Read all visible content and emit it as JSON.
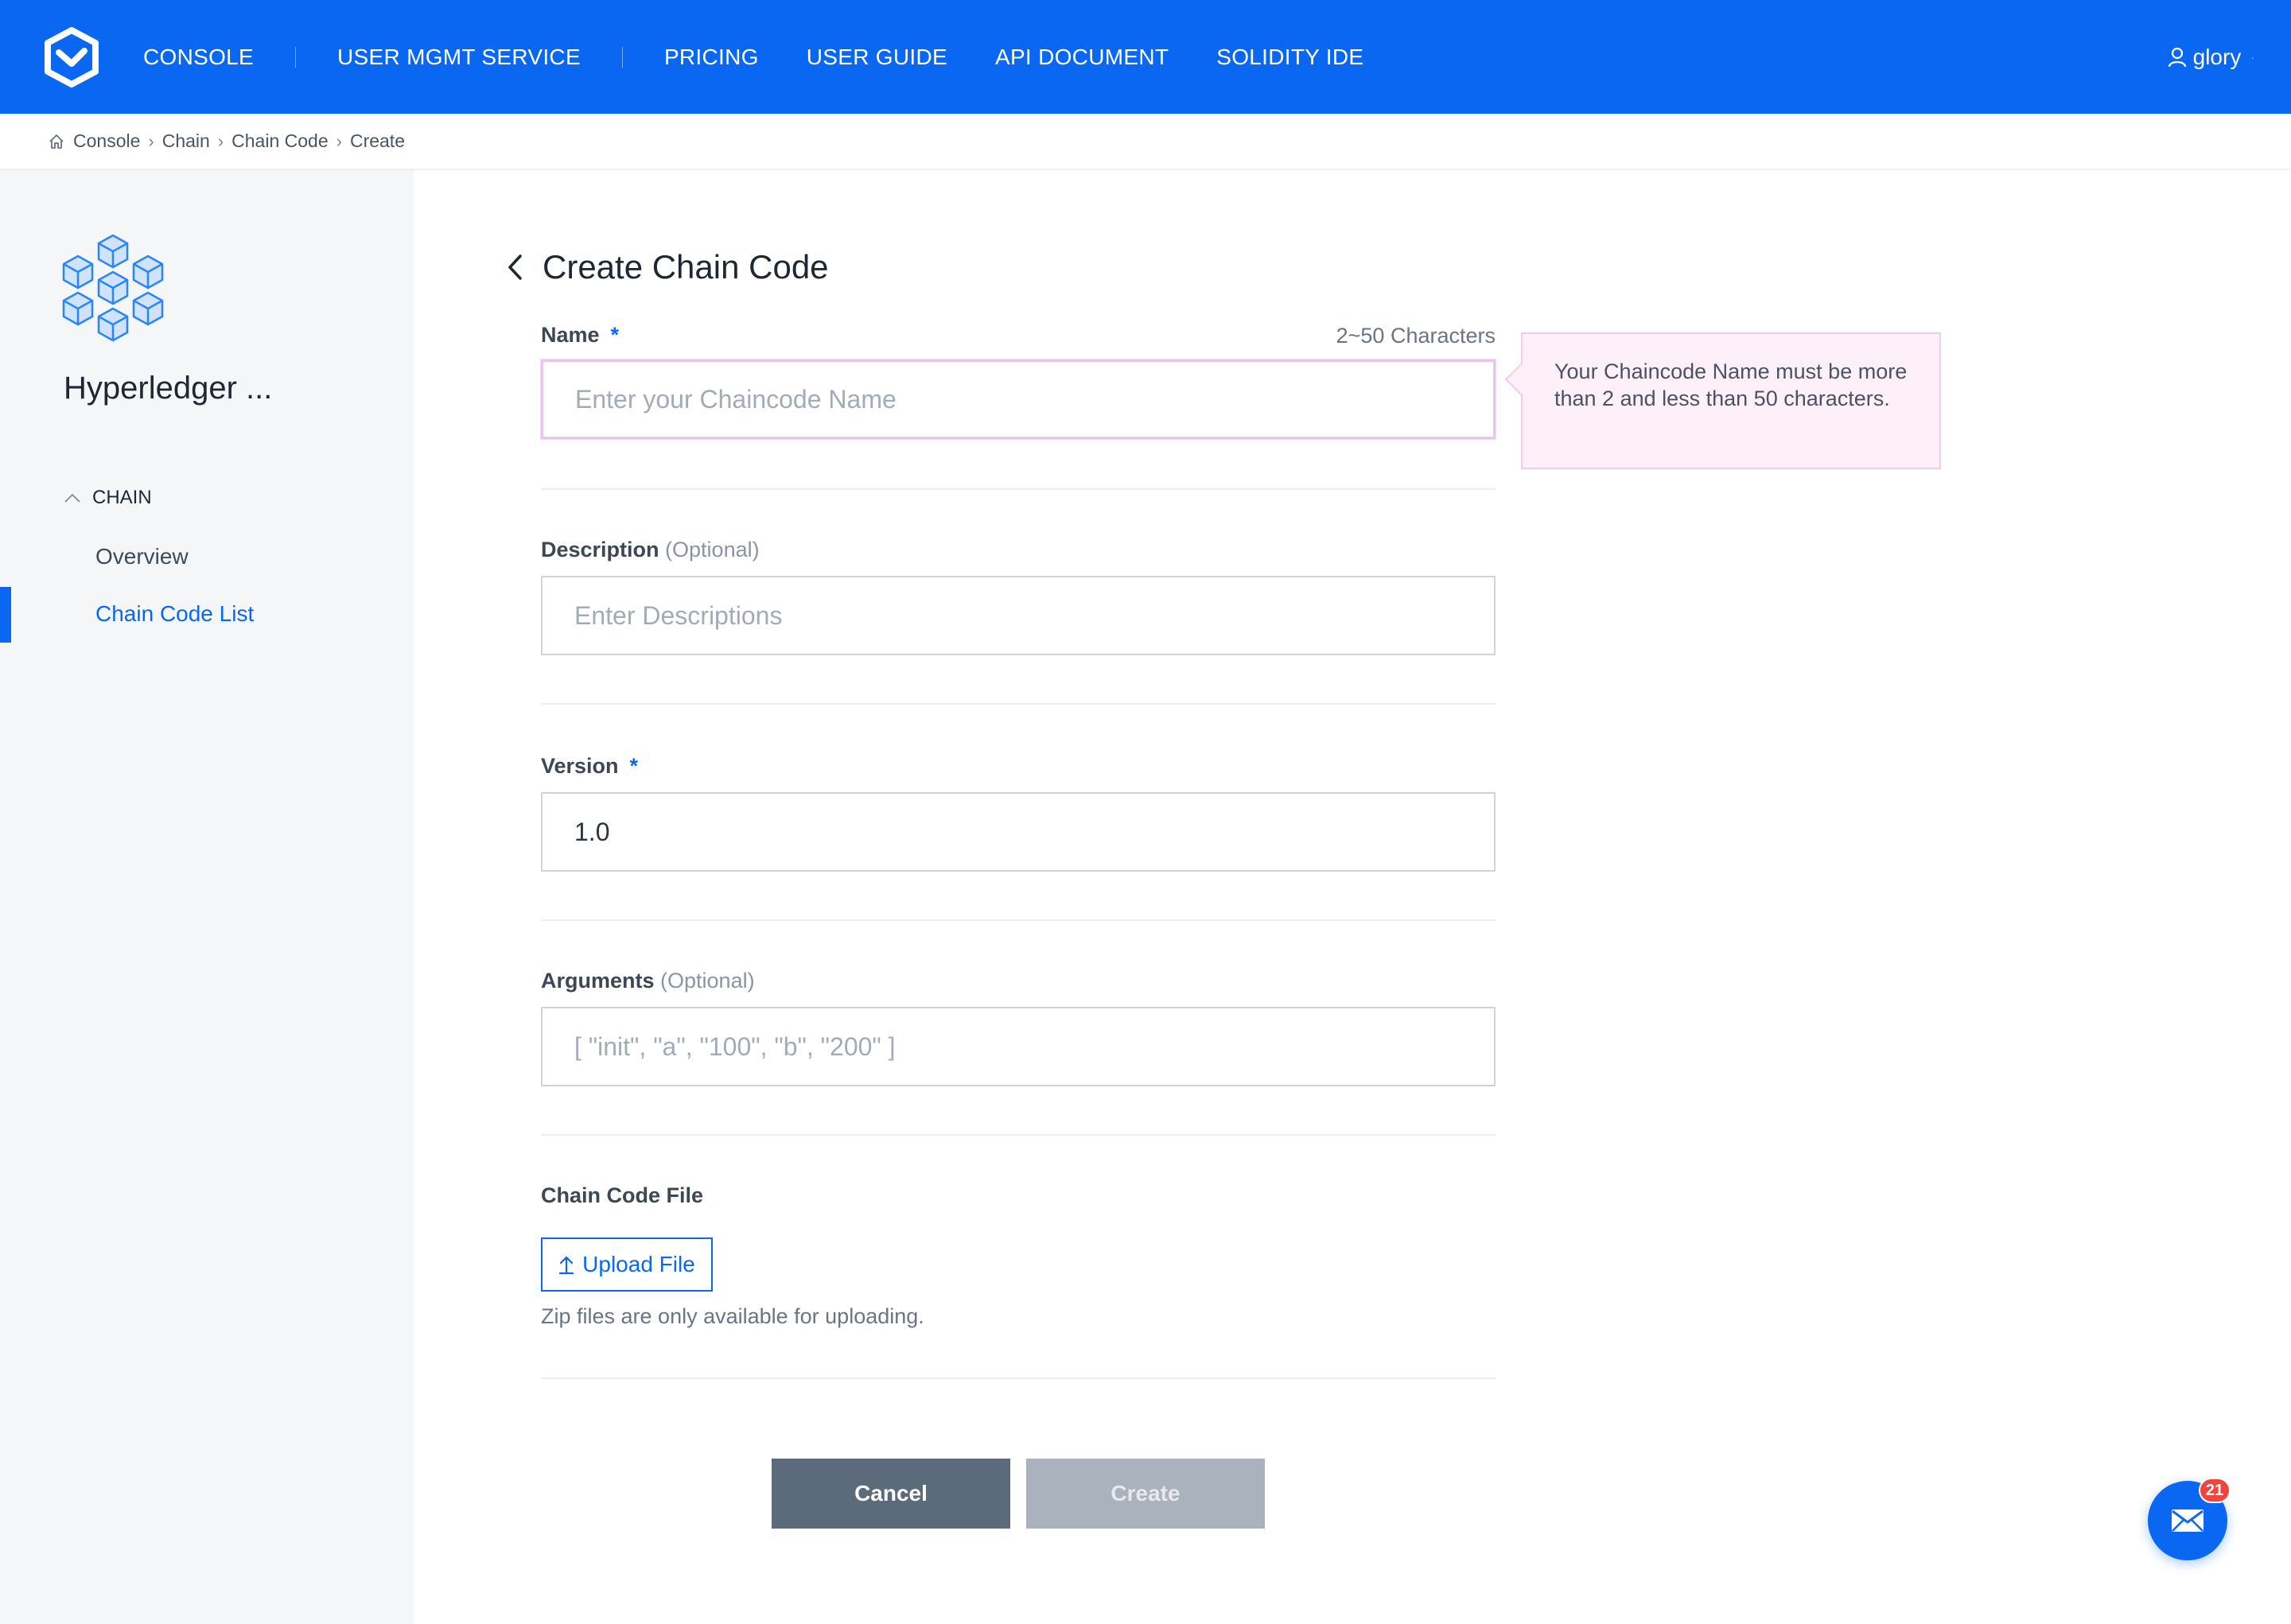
{
  "nav": {
    "items": [
      "CONSOLE",
      "USER MGMT SERVICE",
      "PRICING",
      "USER GUIDE",
      "API DOCUMENT",
      "SOLIDITY IDE"
    ],
    "user": "glory"
  },
  "breadcrumb": [
    "Console",
    "Chain",
    "Chain Code",
    "Create"
  ],
  "sidebar": {
    "title": "Hyperledger ...",
    "group": "CHAIN",
    "items": [
      "Overview",
      "Chain Code List"
    ],
    "active_item": "Chain Code List"
  },
  "page": {
    "title": "Create Chain Code"
  },
  "form": {
    "name": {
      "label": "Name",
      "required_mark": "*",
      "hint": "2~50 Characters",
      "placeholder": "Enter your Chaincode Name",
      "value": "",
      "error_tooltip": "Your Chaincode Name must be more than 2 and less than 50 characters."
    },
    "description": {
      "label": "Description",
      "optional": "(Optional)",
      "placeholder": "Enter Descriptions",
      "value": ""
    },
    "version": {
      "label": "Version",
      "required_mark": "*",
      "value": "1.0"
    },
    "arguments": {
      "label": "Arguments",
      "optional": "(Optional)",
      "placeholder": "[ \"init\", \"a\", \"100\", \"b\", \"200\" ]",
      "value": ""
    },
    "file": {
      "label": "Chain Code File",
      "upload_label": "Upload File",
      "note": "Zip files are only available for uploading."
    }
  },
  "actions": {
    "cancel": "Cancel",
    "create": "Create"
  },
  "messages": {
    "badge_count": "21"
  },
  "colors": {
    "brand": "#0a67f2",
    "error_border": "#e8c5ea",
    "tooltip_bg": "#fdf0f8",
    "cancel_bg": "#5c6b7b",
    "create_disabled_bg": "#aab2bd",
    "badge": "#f0433a"
  },
  "icons": [
    "brand-logo-icon",
    "user-icon",
    "home-icon",
    "hyperledger-cubes-icon",
    "chevron-up-icon",
    "back-arrow-icon",
    "upload-arrow-icon",
    "mail-icon"
  ]
}
